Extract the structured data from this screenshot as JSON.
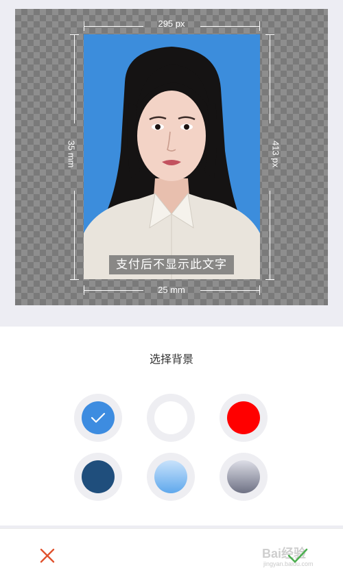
{
  "preview": {
    "width_px_label": "295 px",
    "height_px_label": "413 px",
    "height_mm_label": "35 mm",
    "width_mm_label": "25 mm",
    "watermark_caption": "支付后不显示此文字",
    "photo_bg_color": "#3c8ddc"
  },
  "sheet": {
    "title": "选择背景",
    "selected_index": 0,
    "backgrounds": [
      {
        "name": "blue",
        "fill": "#3d8ce0"
      },
      {
        "name": "white",
        "fill": "#ffffff"
      },
      {
        "name": "red",
        "fill": "#ff0000"
      },
      {
        "name": "dark-blue",
        "fill": "#1f4e7c"
      },
      {
        "name": "blue-gradient",
        "fill": "linear-gradient(180deg, #c8e2fb 0%, #5fa8ec 100%)"
      },
      {
        "name": "gray-gradient",
        "fill": "linear-gradient(180deg, #dcdde6 0%, #6e7184 100%)"
      }
    ]
  },
  "bottom_bar": {
    "close_icon": "x-icon",
    "confirm_icon": "check-icon",
    "accent_color": "#e0522e",
    "watermark_text": "Bai经验",
    "watermark_sub": "jingyan.baidu.com"
  }
}
